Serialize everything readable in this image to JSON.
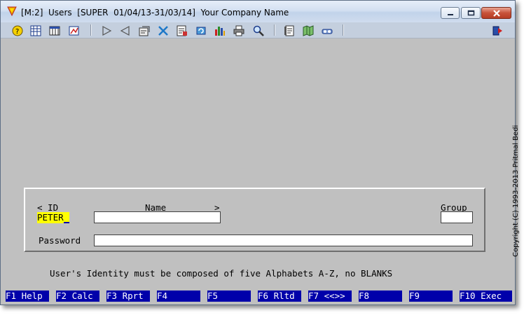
{
  "window": {
    "title": "[M:2]  Users  [SUPER  01/04/13-31/03/14]  Your Company Name",
    "controls": {
      "minimize": "minimize",
      "maximize": "maximize",
      "close": "close"
    }
  },
  "toolbar": {
    "icons": [
      "help-icon",
      "grid-icon",
      "table-icon",
      "report-icon",
      "next-icon",
      "previous-icon",
      "properties-icon",
      "tools-icon",
      "edit-icon",
      "refresh-icon",
      "bar-chart-icon",
      "print-icon",
      "find-icon",
      "notes-icon",
      "map-icon",
      "settings-icon",
      "exit-icon"
    ]
  },
  "form": {
    "id_header": "< ID",
    "name_header": "Name",
    "name_arrow": ">",
    "group_header": "Group",
    "id_value": "PETER",
    "name_value": "",
    "group_value": "",
    "password_label": "Password",
    "password_value": ""
  },
  "message": "User's Identity must be composed of five Alphabets A-Z, no BLANKS",
  "copyright": "Copyright (C) 1993-2013  Pritmal Bedi",
  "fkeys": [
    "F1 Help",
    "F2 Calc",
    "F3 Rprt",
    "F4",
    "F5",
    "F6 Rltd",
    "F7 <<>>",
    "F8",
    "F9",
    "F10 Exec"
  ],
  "colors": {
    "background": "#c0c0c0",
    "fkey_bg": "#0000aa",
    "highlight": "#ffff00"
  }
}
